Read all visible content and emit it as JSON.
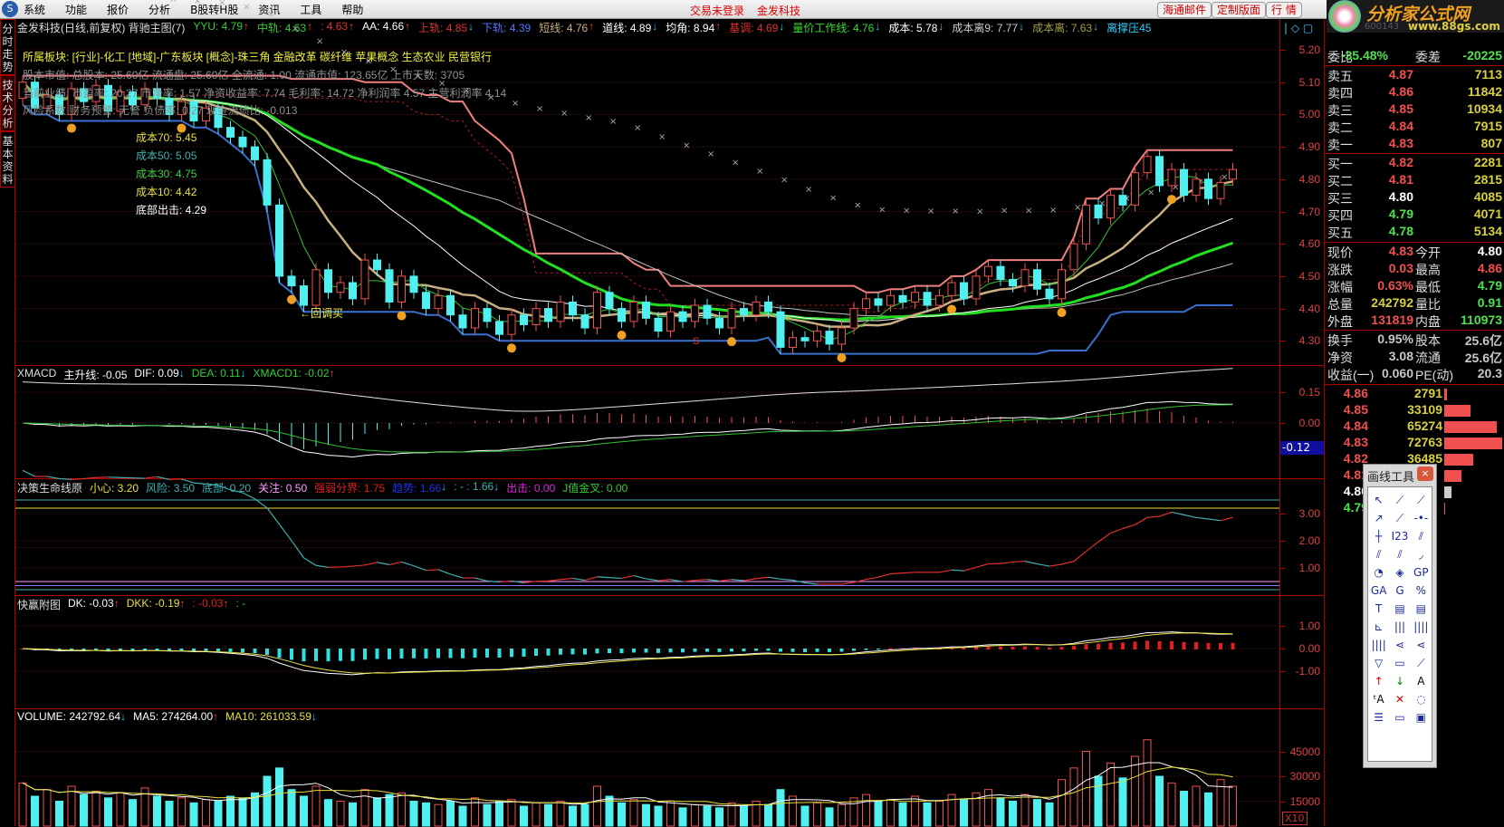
{
  "menu": {
    "items": [
      "系统",
      "功能",
      "报价",
      "分析",
      "B股转H股",
      "资讯",
      "工具",
      "帮助"
    ],
    "status": [
      "交易未登录",
      "金发科技"
    ],
    "buttons": [
      "海通邮件",
      "定制版面",
      "行 情"
    ]
  },
  "logo": {
    "text": "分析家公式网",
    "url": "www.88gs.com",
    "code": "600143"
  },
  "left_tabs": [
    "分时走势",
    "技术分析",
    "基本资料"
  ],
  "main": {
    "title": "金发科技(日线,前复权) 背驰主图(7)",
    "indicators": [
      {
        "label": "YYU: 4.79",
        "dir": "up",
        "color": "#33cc33"
      },
      {
        "label": "中轨: 4.63",
        "dir": "up",
        "color": "#33cc33"
      },
      {
        "label": ": 4.63",
        "dir": "up",
        "color": "#e03030"
      },
      {
        "label": "AA: 4.66",
        "dir": "up",
        "color": "#ffffff"
      },
      {
        "label": "上轨: 4.85",
        "dir": "dn",
        "color": "#e03030"
      },
      {
        "label": "下轨: 4.39",
        "dir": "",
        "color": "#4a78ff"
      },
      {
        "label": "短线: 4.76",
        "dir": "up",
        "color": "#c8b080"
      },
      {
        "label": "道线: 4.89",
        "dir": "dn",
        "color": "#ffffff"
      },
      {
        "label": "均角: 8.94",
        "dir": "up",
        "color": "#ffffff"
      },
      {
        "label": "基调: 4.69",
        "dir": "dn",
        "color": "#e03030"
      },
      {
        "label": "量价工作线: 4.76",
        "dir": "dn",
        "color": "#33dd33"
      },
      {
        "label": "成本: 5.78",
        "dir": "dn",
        "color": "#ffffff"
      },
      {
        "label": "成本离9: 7.77",
        "dir": "dn",
        "color": "#cccccc"
      },
      {
        "label": "成本离: 7.63",
        "dir": "dn",
        "color": "#a0a040"
      },
      {
        "label": "离撑压45",
        "dir": "",
        "color": "#33ccff"
      }
    ],
    "info_lines": [
      "所属板块: [行业]-化工 [地域]-广东板块 [概念]-珠三角 金融改革 碳纤维 苹果概念 生态农业 民营银行",
      "股本市值: 总股本: 25.60亿 流通盘: 25.60亿 全流通: 1.00 流通市值: 123.65亿 上市天数: 3705",
      "当前业绩: 市盈率: 20.27 市净率: 1.57 净资收益率: 7.74 毛利率: 14.72 净利润率 4.57 主营利润率 4.14",
      "风险系数 财务预警: 无警 负债率: 0.27 现金流债比: -0.013"
    ],
    "cost_labels": [
      {
        "text": "成本70: 5.45",
        "color": "#e8e040"
      },
      {
        "text": "成本50: 5.05",
        "color": "#40b0b0"
      },
      {
        "text": "成本30: 4.75",
        "color": "#40d040"
      },
      {
        "text": "成本10: 4.42",
        "color": "#e8e040"
      },
      {
        "text": "底部出击: 4.29",
        "color": "#ffffff"
      }
    ],
    "annotation": "←回调买",
    "signal_mark": "S"
  },
  "xmacd": {
    "title": "XMACD",
    "items": [
      {
        "label": "主升线: -0.05",
        "dir": "",
        "color": "#ffffff"
      },
      {
        "label": "DIF: 0.09",
        "dir": "dn",
        "color": "#ffffff"
      },
      {
        "label": "DEA: 0.11",
        "dir": "dn",
        "color": "#33cc33"
      },
      {
        "label": "XMACD1: -0.02",
        "dir": "up",
        "color": "#33cc33"
      }
    ],
    "current": "-0.12"
  },
  "decision": {
    "title": "决策生命线原",
    "items": [
      {
        "label": "小心: 3.20",
        "dir": "",
        "color": "#e8e040"
      },
      {
        "label": "风险: 3.50",
        "dir": "",
        "color": "#40b0b0"
      },
      {
        "label": "底部: 0.20",
        "dir": "",
        "color": "#40b0b0"
      },
      {
        "label": "关注: 0.50",
        "dir": "",
        "color": "#ff99ff"
      },
      {
        "label": "强弱分界: 1.75",
        "dir": "",
        "color": "#e02020"
      },
      {
        "label": "趋势: 1.66",
        "dir": "dn",
        "color": "#2030e0"
      },
      {
        "label": ": - : 1.66",
        "dir": "dn",
        "color": "#40b0b0"
      },
      {
        "label": "出击: 0.00",
        "dir": "",
        "color": "#e020e0"
      },
      {
        "label": "J值金叉: 0.00",
        "dir": "",
        "color": "#33cc33"
      }
    ]
  },
  "kuaiying": {
    "title": "快赢附图",
    "items": [
      {
        "label": "DK: -0.03",
        "dir": "up",
        "color": "#ffffff"
      },
      {
        "label": "DKK: -0.19",
        "dir": "up",
        "color": "#e8e040"
      },
      {
        "label": ": -0.03",
        "dir": "up",
        "color": "#e02020"
      },
      {
        "label": ": -",
        "dir": "",
        "color": "#33cc33"
      }
    ]
  },
  "volume": {
    "items": [
      {
        "label": "VOLUME: 242792.64",
        "dir": "dn",
        "color": "#ffffff"
      },
      {
        "label": "MA5: 274264.00",
        "dir": "up",
        "color": "#ffffff"
      },
      {
        "label": "MA10: 261033.59",
        "dir": "dn",
        "color": "#e8e040"
      }
    ],
    "unit": "X10"
  },
  "quote": {
    "weibi": {
      "label": "委比",
      "value": "-35.48%",
      "label2": "委差",
      "value2": "-20225"
    },
    "sell": [
      {
        "l": "卖五",
        "p": "4.87",
        "v": "7113"
      },
      {
        "l": "卖四",
        "p": "4.86",
        "v": "11842"
      },
      {
        "l": "卖三",
        "p": "4.85",
        "v": "10934"
      },
      {
        "l": "卖二",
        "p": "4.84",
        "v": "7915"
      },
      {
        "l": "卖一",
        "p": "4.83",
        "v": "807"
      }
    ],
    "buy": [
      {
        "l": "买一",
        "p": "4.82",
        "v": "2281",
        "c": "#f05050"
      },
      {
        "l": "买二",
        "p": "4.81",
        "v": "2815",
        "c": "#f05050"
      },
      {
        "l": "买三",
        "p": "4.80",
        "v": "4085",
        "c": "#ffffff"
      },
      {
        "l": "买四",
        "p": "4.79",
        "v": "4071",
        "c": "#50e050"
      },
      {
        "l": "买五",
        "p": "4.78",
        "v": "5134",
        "c": "#50e050"
      }
    ],
    "stats": [
      {
        "l": "现价",
        "v": "4.83",
        "c": "#f05050",
        "l2": "今开",
        "v2": "4.80",
        "c2": "#ffffff"
      },
      {
        "l": "涨跌",
        "v": "0.03",
        "c": "#f05050",
        "l2": "最高",
        "v2": "4.86",
        "c2": "#f05050"
      },
      {
        "l": "涨幅",
        "v": "0.63%",
        "c": "#f05050",
        "l2": "最低",
        "v2": "4.79",
        "c2": "#50e050"
      },
      {
        "l": "总量",
        "v": "242792",
        "c": "#d8d040",
        "l2": "量比",
        "v2": "0.91",
        "c2": "#50e050"
      },
      {
        "l": "外盘",
        "v": "131819",
        "c": "#f05050",
        "l2": "内盘",
        "v2": "110973",
        "c2": "#50e050"
      }
    ],
    "fund": [
      {
        "l": "换手",
        "v": "0.95%",
        "l2": "股本",
        "v2": "25.6亿"
      },
      {
        "l": "净资",
        "v": "3.08",
        "l2": "流通",
        "v2": "25.6亿"
      },
      {
        "l": "收益(一)",
        "v": "0.060",
        "l2": "PE(动)",
        "v2": "20.3"
      }
    ],
    "price_volume": [
      {
        "p": "4.86",
        "v": "2791",
        "share": 0.04,
        "c": "#f05050"
      },
      {
        "p": "4.85",
        "v": "33109",
        "share": 0.45,
        "c": "#f05050"
      },
      {
        "p": "4.84",
        "v": "65274",
        "share": 0.9,
        "c": "#f05050"
      },
      {
        "p": "4.83",
        "v": "72763",
        "share": 1.0,
        "c": "#f05050"
      },
      {
        "p": "4.82",
        "v": "36485",
        "share": 0.5,
        "c": "#f05050"
      },
      {
        "p": "4.81",
        "v": "",
        "share": 0.3,
        "c": "#f05050"
      },
      {
        "p": "4.80",
        "v": "",
        "share": 0.12,
        "c": "#ffffff"
      },
      {
        "p": "4.79",
        "v": "",
        "share": 0.01,
        "c": "#50e050"
      }
    ]
  },
  "draw_tools": {
    "title": "画线工具",
    "close": "×",
    "tools": [
      "↖",
      "⟋",
      "⟋",
      "↗",
      "⟋",
      "-•-",
      "┼",
      "I23",
      "⫽",
      "⫽",
      "⫽",
      "◞",
      "◔",
      "◈",
      "GP",
      "GA",
      "G",
      "%",
      "T",
      "▤",
      "▤",
      "⊾",
      "|||",
      "||||",
      "||||",
      "⋖",
      "⋖",
      "▽",
      "▭",
      "⟋",
      "↑",
      "↓",
      "A",
      "ᵗA",
      "✕",
      "◌",
      "☰",
      "▭",
      "▣"
    ]
  },
  "chart_data": {
    "type": "candlestick",
    "price_ticks": [
      5.2,
      5.1,
      5.0,
      4.9,
      4.8,
      4.7,
      4.6,
      4.5,
      4.4,
      4.3
    ],
    "xmacd_ticks": [
      0.15,
      0.0
    ],
    "decision_ticks": [
      3.0,
      2.0,
      1.0
    ],
    "kuaiying_ticks": [
      1.0,
      0.0,
      -1.0
    ],
    "volume_ticks": [
      45000,
      30000,
      15000
    ],
    "oc": [
      [
        5.05,
        5.1
      ],
      [
        5.1,
        5.02
      ],
      [
        5.02,
        5.06
      ],
      [
        5.06,
        5.0
      ],
      [
        5.0,
        5.08
      ],
      [
        5.08,
        5.04
      ],
      [
        5.04,
        5.09
      ],
      [
        5.09,
        5.01
      ],
      [
        5.01,
        5.07
      ],
      [
        5.07,
        5.03
      ],
      [
        5.03,
        5.08
      ],
      [
        5.08,
        5.05
      ],
      [
        5.05,
        5.0
      ],
      [
        5.0,
        5.04
      ],
      [
        5.04,
        4.98
      ],
      [
        4.98,
        5.02
      ],
      [
        5.02,
        4.96
      ],
      [
        4.96,
        4.93
      ],
      [
        4.93,
        4.9
      ],
      [
        4.9,
        4.86
      ],
      [
        4.86,
        4.72
      ],
      [
        4.72,
        4.5
      ],
      [
        4.5,
        4.47
      ],
      [
        4.47,
        4.41
      ],
      [
        4.41,
        4.52
      ],
      [
        4.52,
        4.45
      ],
      [
        4.45,
        4.48
      ],
      [
        4.48,
        4.43
      ],
      [
        4.43,
        4.55
      ],
      [
        4.55,
        4.52
      ],
      [
        4.52,
        4.42
      ],
      [
        4.42,
        4.5
      ],
      [
        4.5,
        4.45
      ],
      [
        4.45,
        4.4
      ],
      [
        4.4,
        4.44
      ],
      [
        4.44,
        4.38
      ],
      [
        4.38,
        4.34
      ],
      [
        4.34,
        4.4
      ],
      [
        4.4,
        4.36
      ],
      [
        4.36,
        4.32
      ],
      [
        4.32,
        4.38
      ],
      [
        4.38,
        4.35
      ],
      [
        4.35,
        4.4
      ],
      [
        4.4,
        4.36
      ],
      [
        4.36,
        4.42
      ],
      [
        4.42,
        4.38
      ],
      [
        4.38,
        4.34
      ],
      [
        4.34,
        4.45
      ],
      [
        4.45,
        4.4
      ],
      [
        4.4,
        4.36
      ],
      [
        4.36,
        4.42
      ],
      [
        4.42,
        4.37
      ],
      [
        4.37,
        4.33
      ],
      [
        4.33,
        4.39
      ],
      [
        4.39,
        4.36
      ],
      [
        4.36,
        4.41
      ],
      [
        4.41,
        4.37
      ],
      [
        4.37,
        4.34
      ],
      [
        4.34,
        4.4
      ],
      [
        4.4,
        4.38
      ],
      [
        4.38,
        4.42
      ],
      [
        4.42,
        4.39
      ],
      [
        4.39,
        4.28
      ],
      [
        4.28,
        4.31
      ],
      [
        4.31,
        4.3
      ],
      [
        4.3,
        4.33
      ],
      [
        4.33,
        4.29
      ],
      [
        4.29,
        4.34
      ],
      [
        4.34,
        4.4
      ],
      [
        4.4,
        4.43
      ],
      [
        4.43,
        4.41
      ],
      [
        4.41,
        4.44
      ],
      [
        4.44,
        4.42
      ],
      [
        4.42,
        4.45
      ],
      [
        4.45,
        4.41
      ],
      [
        4.41,
        4.44
      ],
      [
        4.44,
        4.48
      ],
      [
        4.48,
        4.43
      ],
      [
        4.43,
        4.5
      ],
      [
        4.5,
        4.53
      ],
      [
        4.53,
        4.49
      ],
      [
        4.49,
        4.47
      ],
      [
        4.47,
        4.52
      ],
      [
        4.52,
        4.46
      ],
      [
        4.46,
        4.43
      ],
      [
        4.43,
        4.52
      ],
      [
        4.52,
        4.6
      ],
      [
        4.6,
        4.72
      ],
      [
        4.72,
        4.68
      ],
      [
        4.68,
        4.75
      ],
      [
        4.75,
        4.72
      ],
      [
        4.72,
        4.82
      ],
      [
        4.82,
        4.87
      ],
      [
        4.87,
        4.78
      ],
      [
        4.78,
        4.83
      ],
      [
        4.83,
        4.75
      ],
      [
        4.75,
        4.8
      ],
      [
        4.8,
        4.74
      ],
      [
        4.74,
        4.79
      ],
      [
        4.8,
        4.83
      ]
    ],
    "volume": [
      26000,
      18000,
      22000,
      15000,
      24000,
      19000,
      21000,
      17000,
      20000,
      16000,
      23000,
      18000,
      15000,
      17000,
      14000,
      16000,
      15000,
      18000,
      17000,
      20000,
      30000,
      35000,
      22000,
      18000,
      24000,
      16000,
      15000,
      14000,
      22000,
      17000,
      19000,
      20000,
      15000,
      14000,
      13000,
      15000,
      12000,
      17000,
      13000,
      15000,
      16000,
      12000,
      14000,
      13000,
      15000,
      12000,
      13000,
      24000,
      18000,
      14000,
      16000,
      13000,
      12000,
      15000,
      11000,
      13000,
      12000,
      11000,
      14000,
      12000,
      15000,
      13000,
      22000,
      18000,
      12000,
      14000,
      11000,
      13000,
      17000,
      19000,
      15000,
      16000,
      14000,
      18000,
      14000,
      15000,
      19000,
      16000,
      20000,
      22000,
      17000,
      15000,
      19000,
      16000,
      14000,
      28000,
      35000,
      45000,
      30000,
      38000,
      29000,
      42000,
      52000,
      30000,
      26000,
      21000,
      24000,
      20000,
      28000,
      24000
    ]
  }
}
